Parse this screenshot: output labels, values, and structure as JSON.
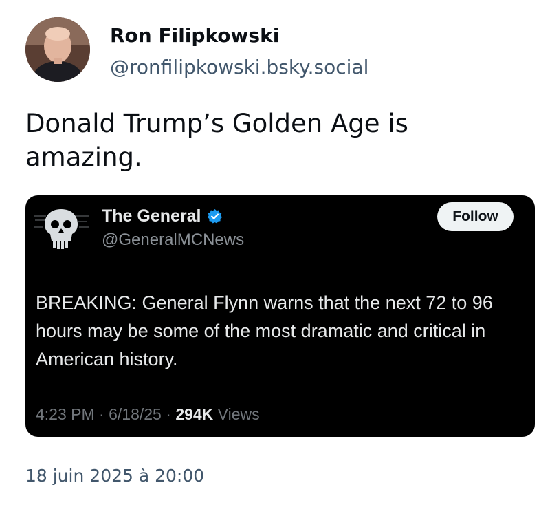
{
  "author": {
    "name": "Ron Filipkowski",
    "handle": "@ronfilipkowski.bsky.social",
    "avatar_icon": "person-photo-avatar"
  },
  "post": {
    "text": "Donald Trump’s Golden Age is amazing.",
    "date": "18 juin 2025 à 20:00"
  },
  "embed": {
    "name": "The General",
    "handle": "@GeneralMCNews",
    "verified_icon": "verified-badge-icon",
    "avatar_icon": "skull-logo-avatar",
    "follow_label": "Follow",
    "text": "BREAKING: General Flynn warns that the next 72 to 96 hours may be some of the most dramatic and critical in American history.",
    "time": "4:23 PM",
    "sep1": " · ",
    "date": "6/18/25",
    "sep2": " · ",
    "views_count": "294K",
    "views_label": " Views"
  },
  "colors": {
    "text_primary": "#0b0f14",
    "text_secondary": "#42576c",
    "embed_background": "#000000",
    "verified_blue": "#1d9bf0"
  }
}
